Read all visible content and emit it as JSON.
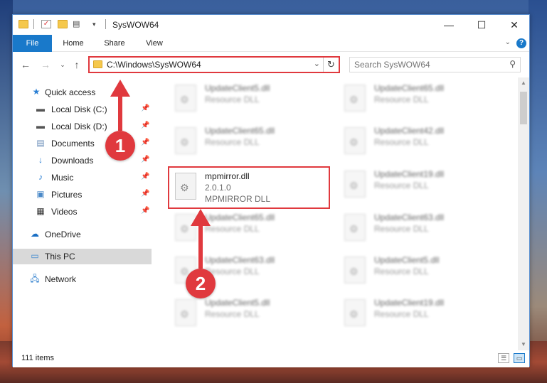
{
  "window": {
    "title": "SysWOW64"
  },
  "titlebar": {
    "minimize": "—",
    "maximize": "☐",
    "close": "✕"
  },
  "ribbon": {
    "tabs": [
      "File",
      "Home",
      "Share",
      "View"
    ],
    "help": "?"
  },
  "address": {
    "path": "C:\\Windows\\SysWOW64"
  },
  "search": {
    "placeholder": "Search SysWOW64"
  },
  "sidebar": {
    "items": [
      {
        "label": "Quick access",
        "icon": "star-icon"
      },
      {
        "label": "Local Disk (C:)",
        "icon": "drive-icon"
      },
      {
        "label": "Local Disk (D:)",
        "icon": "drive-icon"
      },
      {
        "label": "Documents",
        "icon": "documents-icon"
      },
      {
        "label": "Downloads",
        "icon": "download-icon"
      },
      {
        "label": "Music",
        "icon": "music-icon"
      },
      {
        "label": "Pictures",
        "icon": "pictures-icon"
      },
      {
        "label": "Videos",
        "icon": "videos-icon"
      },
      {
        "label": "OneDrive",
        "icon": "cloud-icon"
      },
      {
        "label": "This PC",
        "icon": "pc-icon"
      },
      {
        "label": "Network",
        "icon": "network-icon"
      }
    ]
  },
  "files": {
    "left": [
      {
        "name": "UpdateClient5.dll",
        "desc": "Resource DLL"
      },
      {
        "name": "UpdateClient65.dll",
        "desc": "Resource DLL"
      },
      {
        "name": "mpmirror.dll",
        "version": "2.0.1.0",
        "desc": "MPMIRROR DLL"
      },
      {
        "name": "UpdateClient65.dll",
        "desc": "Resource DLL"
      },
      {
        "name": "UpdateClient63.dll",
        "desc": "Resource DLL"
      },
      {
        "name": "UpdateClient5.dll",
        "desc": "Resource DLL"
      }
    ],
    "right": [
      {
        "name": "UpdateClient65.dll",
        "desc": "Resource DLL"
      },
      {
        "name": "UpdateClient42.dll",
        "desc": "Resource DLL"
      },
      {
        "name": "UpdateClient19.dll",
        "desc": "Resource DLL"
      },
      {
        "name": "UpdateClient63.dll",
        "desc": "Resource DLL"
      },
      {
        "name": "UpdateClient5.dll",
        "desc": "Resource DLL"
      },
      {
        "name": "UpdateClient19.dll",
        "desc": "Resource DLL"
      }
    ]
  },
  "status": {
    "count": "111 items"
  },
  "markers": {
    "one": "1",
    "two": "2"
  },
  "colors": {
    "accent": "#1979ca",
    "highlight": "#e0393e"
  }
}
